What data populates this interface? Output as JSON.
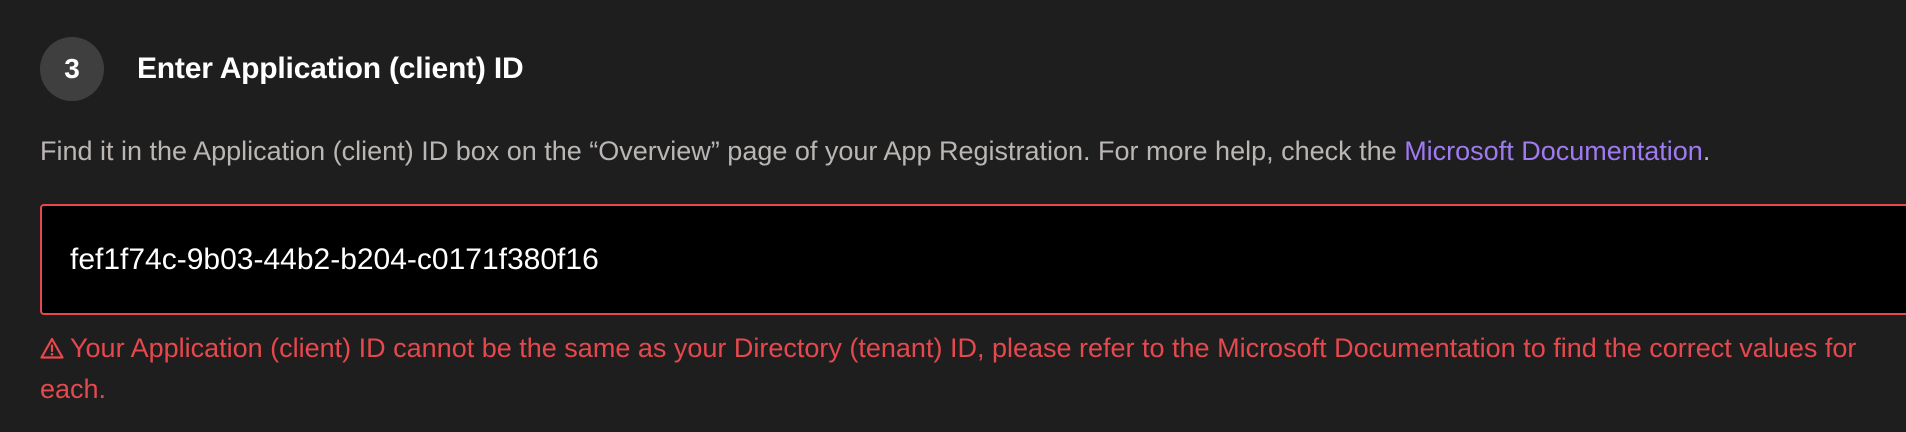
{
  "step": {
    "number": "3",
    "title": "Enter Application (client) ID"
  },
  "help": {
    "text_before": "Find it in the Application (client) ID box on the “Overview” page of your App Registration. For more help, check the ",
    "link_label": "Microsoft Documentation",
    "text_after": "."
  },
  "client_id_field": {
    "value": "fef1f74c-9b03-44b2-b204-c0171f380f16",
    "state": "error"
  },
  "error": {
    "icon": "warning-triangle-icon",
    "message": "Your Application (client) ID cannot be the same as your Directory (tenant) ID, please refer to the Microsoft Documentation to find the correct values for each."
  },
  "colors": {
    "background": "#1f1e1e",
    "badge": "#3f3f3f",
    "link": "#9f7af0",
    "error": "#e5484d",
    "muted_text": "#b9b6b4"
  }
}
